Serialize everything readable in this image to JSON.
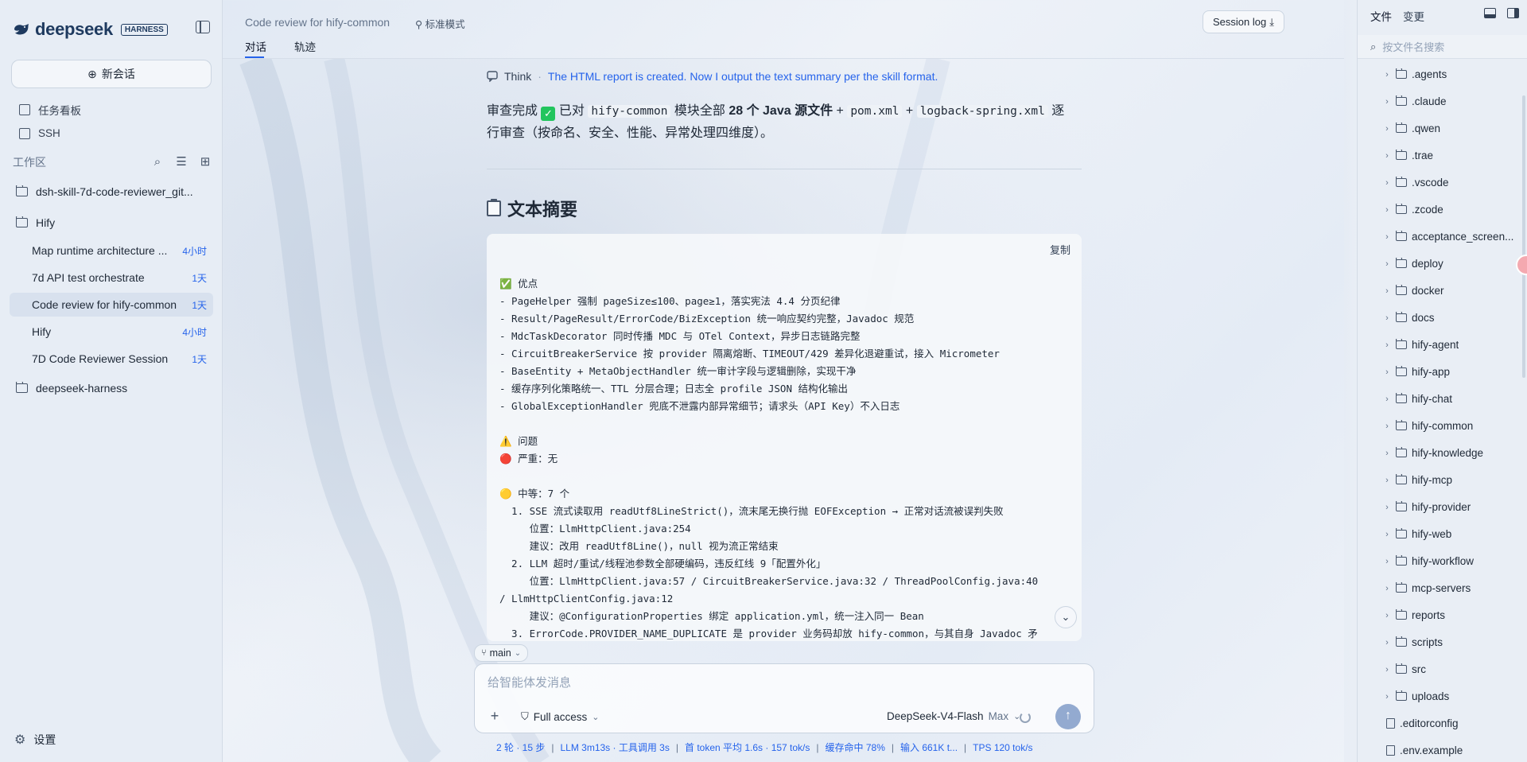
{
  "sidebar": {
    "logo_text": "deepseek",
    "logo_badge": "HARNESS",
    "new_chat_label": "新会话",
    "nav": [
      {
        "label": "任务看板",
        "icon": "kanban-icon"
      },
      {
        "label": "SSH",
        "icon": "terminal-icon"
      }
    ],
    "workspace_title": "工作区",
    "folders": [
      {
        "label": "dsh-skill-7d-code-reviewer_git..."
      },
      {
        "label": "Hify"
      }
    ],
    "sessions": [
      {
        "title": "Map runtime architecture ...",
        "age": "4小时"
      },
      {
        "title": "7d API test orchestrate",
        "age": "1天"
      },
      {
        "title": "Code review for hify-common",
        "age": "1天"
      },
      {
        "title": "Hify",
        "age": "4小时"
      },
      {
        "title": "7D Code Reviewer Session",
        "age": "1天"
      }
    ],
    "folder_bottom": "deepseek-harness",
    "settings_label": "设置"
  },
  "header": {
    "title": "Code review for hify-common",
    "mode": "标准模式",
    "tabs": [
      "对话",
      "轨迹"
    ],
    "session_log_label": "Session log"
  },
  "conversation": {
    "think_label": "Think",
    "think_dot": "·",
    "think_text": "The HTML report is created. Now I output the text summary per the skill format.",
    "summary_parts": {
      "p1": "审查完成",
      "p2": "已对",
      "code1": "hify-common",
      "p3": "模块全部",
      "bold1": "28 个 Java 源文件",
      "p4": "+",
      "code2": "pom.xml",
      "p5": "+",
      "code3": "logback-spring.xml",
      "p6": "逐行审查（按命名、安全、性能、异常处理四维度）。"
    },
    "heading": "文本摘要",
    "copy_label": "复制",
    "code_lines": [
      "✅ 优点",
      "- PageHelper 强制 pageSize≤100、page≥1，落实宪法 4.4 分页纪律",
      "- Result/PageResult/ErrorCode/BizException 统一响应契约完整，Javadoc 规范",
      "- MdcTaskDecorator 同时传播 MDC 与 OTel Context，异步日志链路完整",
      "- CircuitBreakerService 按 provider 隔离熔断、TIMEOUT/429 差异化退避重试，接入 Micrometer",
      "- BaseEntity + MetaObjectHandler 统一审计字段与逻辑删除，实现干净",
      "- 缓存序列化策略统一、TTL 分层合理；日志全 profile JSON 结构化输出",
      "- GlobalExceptionHandler 兜底不泄露内部异常细节；请求头（API Key）不入日志",
      "",
      "⚠️ 问题",
      "🔴 严重：无",
      "",
      "🟡 中等：7 个",
      "  1. SSE 流式读取用 readUtf8LineStrict()，流末尾无换行抛 EOFException → 正常对话流被误判失败",
      "     位置：LlmHttpClient.java:254",
      "     建议：改用 readUtf8Line()，null 视为流正常结束",
      "  2. LLM 超时/重试/线程池参数全部硬编码，违反红线 9「配置外化」",
      "     位置：LlmHttpClient.java:57 / CircuitBreakerService.java:32 / ThreadPoolConfig.java:40",
      "/ LlmHttpClientConfig.java:12",
      "     建议：@ConfigurationProperties 绑定 application.yml，统一注入同一 Bean",
      "  3. ErrorCode.PROVIDER_NAME_DUPLICATE 是 provider 业务码却放 hify-common，与其自身 Javadoc 矛"
    ]
  },
  "composer": {
    "branch": "main",
    "placeholder": "给智能体发消息",
    "access_label": "Full access",
    "model_label": "DeepSeek-V4-Flash",
    "model_level": "Max"
  },
  "status": {
    "items": [
      "2 轮 · 15 步",
      "LLM 3m13s · 工具调用 3s",
      "首 token 平均 1.6s · 157 tok/s",
      "缓存命中 78%",
      "输入 661K t...",
      "TPS 120 tok/s"
    ]
  },
  "files_panel": {
    "tabs": [
      "文件",
      "变更"
    ],
    "search_placeholder": "按文件名搜索",
    "entries": [
      {
        "name": ".agents",
        "type": "folder"
      },
      {
        "name": ".claude",
        "type": "folder"
      },
      {
        "name": ".qwen",
        "type": "folder"
      },
      {
        "name": ".trae",
        "type": "folder"
      },
      {
        "name": ".vscode",
        "type": "folder"
      },
      {
        "name": ".zcode",
        "type": "folder"
      },
      {
        "name": "acceptance_screen...",
        "type": "folder"
      },
      {
        "name": "deploy",
        "type": "folder"
      },
      {
        "name": "docker",
        "type": "folder"
      },
      {
        "name": "docs",
        "type": "folder"
      },
      {
        "name": "hify-agent",
        "type": "folder"
      },
      {
        "name": "hify-app",
        "type": "folder"
      },
      {
        "name": "hify-chat",
        "type": "folder"
      },
      {
        "name": "hify-common",
        "type": "folder"
      },
      {
        "name": "hify-knowledge",
        "type": "folder"
      },
      {
        "name": "hify-mcp",
        "type": "folder"
      },
      {
        "name": "hify-provider",
        "type": "folder"
      },
      {
        "name": "hify-web",
        "type": "folder"
      },
      {
        "name": "hify-workflow",
        "type": "folder"
      },
      {
        "name": "mcp-servers",
        "type": "folder"
      },
      {
        "name": "reports",
        "type": "folder"
      },
      {
        "name": "scripts",
        "type": "folder"
      },
      {
        "name": "src",
        "type": "folder"
      },
      {
        "name": "uploads",
        "type": "folder"
      },
      {
        "name": ".editorconfig",
        "type": "file"
      },
      {
        "name": ".env.example",
        "type": "file"
      }
    ]
  },
  "colors": {
    "accent": "#2563eb",
    "sidebar_bg": "#e7edf5",
    "send_button": "#93aad0"
  }
}
